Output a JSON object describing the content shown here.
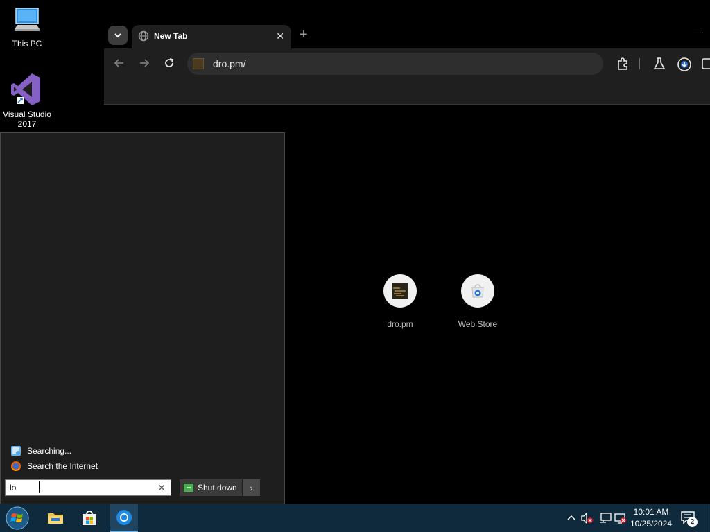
{
  "desktop": {
    "icons": [
      {
        "label": "This PC"
      },
      {
        "label": "Visual Studio 2017"
      }
    ]
  },
  "browser": {
    "tab_title": "New Tab",
    "tab_close": "✕",
    "new_tab": "+",
    "minimize": "—",
    "url": "dro.pm/",
    "shortcuts": [
      {
        "label": "dro.pm"
      },
      {
        "label": "Web Store"
      }
    ]
  },
  "start_menu": {
    "results": [
      {
        "label": "Searching...",
        "icon": "search-results-icon"
      },
      {
        "label": "Search the Internet",
        "icon": "firefox-icon"
      }
    ],
    "search_value": "lo",
    "clear": "✕",
    "shutdown_label": "Shut down",
    "shutdown_arrow": "›"
  },
  "taskbar": {
    "time": "10:01 AM",
    "date": "10/25/2024",
    "notification_count": "2"
  },
  "colors": {
    "taskbar": "#0f2a3c",
    "browser_toolbar": "#1f1f1f",
    "start_menu": "#1e1e1e",
    "vs_purple": "#8661c5"
  }
}
